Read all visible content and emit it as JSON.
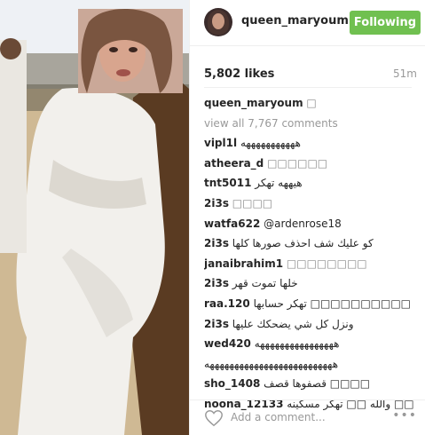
{
  "post": {
    "username": "queen_maryoum",
    "follow_label": "Following",
    "likes": "5,802 likes",
    "time": "51m"
  },
  "comments": {
    "caption": {
      "user": "queen_maryoum",
      "text": "□"
    },
    "view_all": "view all 7,767 comments",
    "items": [
      {
        "user": "vipl1l",
        "text": "هههههههههههه"
      },
      {
        "user": "atheera_d",
        "text": "□□□□□□"
      },
      {
        "user": "tnt5011",
        "text": "هيههه تهكر"
      },
      {
        "user": "2i3s",
        "text": "□□□□"
      },
      {
        "user": "watfa622",
        "text": "@ardenrose18"
      },
      {
        "user": "2i3s",
        "text": "كو عليك شف احذف صورها كلها"
      },
      {
        "user": "janaibrahim1",
        "text": "□□□□□□□□"
      },
      {
        "user": "2i3s",
        "text": "خلها تموت قهر"
      },
      {
        "user": "raa.120",
        "text": "تهكر حسابها □□□□□□□□□□"
      },
      {
        "user": "2i3s",
        "text": "ونزل كل شي يضحكك عليها"
      },
      {
        "user": "wed420",
        "text": "ههههههههههههههههه"
      },
      {
        "user": "",
        "text": "ههههههههههههههههههههههههههه"
      },
      {
        "user": "sho_1408",
        "text": "قصفوها قصف □□□□"
      },
      {
        "user": "noona_12133",
        "text": "والله □□ تهكر مسكينه □□"
      }
    ]
  },
  "footer": {
    "add_comment_placeholder": "Add a comment...",
    "more_label": "•••"
  },
  "icons": {
    "like": "heart-outline-icon",
    "more": "more-options-icon"
  },
  "colors": {
    "follow_button": "#70c050",
    "muted_text": "#999999",
    "mention": "#003569"
  }
}
